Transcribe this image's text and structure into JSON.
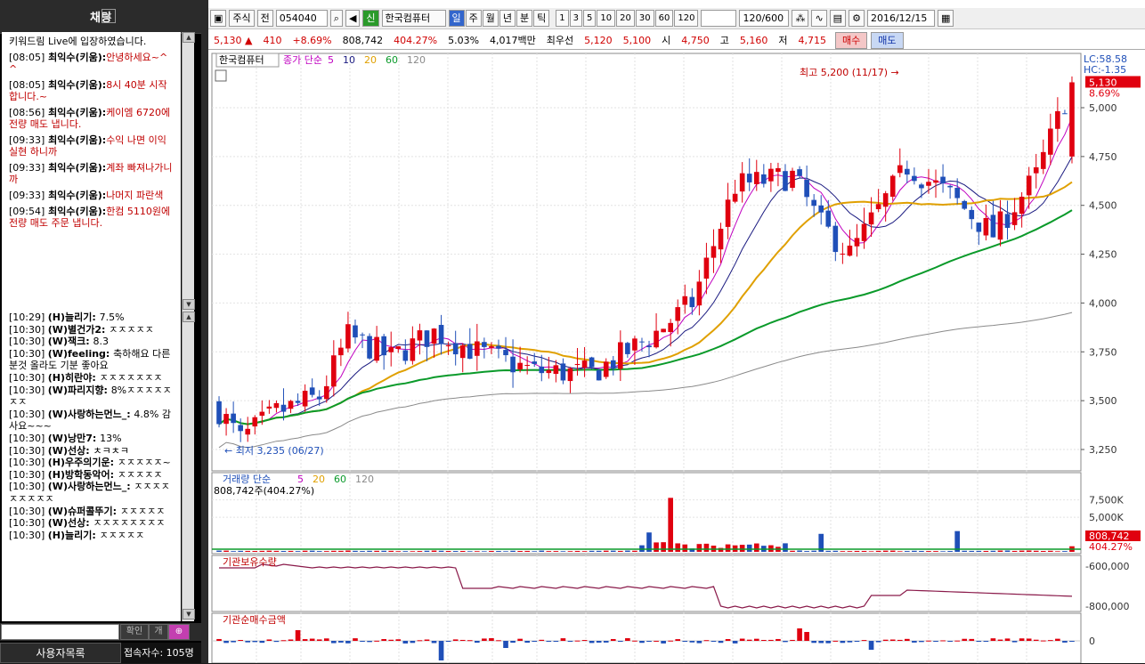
{
  "chat": {
    "title": "채팅",
    "close": "x",
    "messages": [
      {
        "time": "",
        "user": "",
        "text": "키워드림 Live에 입장하였습니다."
      },
      {
        "time": "[08:05]",
        "user": "최익수(키움):",
        "text": "안녕하세요~^^"
      },
      {
        "time": "[08:05]",
        "user": "최익수(키움):",
        "text": "8시 40분 시작합니다.~"
      },
      {
        "time": "[08:56]",
        "user": "최익수(키움):",
        "text": "케이엠 6720에 전량 매도 냅니다."
      },
      {
        "time": "[09:33]",
        "user": "최익수(키움):",
        "text": "수익 나면 이익 실현 하니까"
      },
      {
        "time": "[09:33]",
        "user": "최익수(키움):",
        "text": "계좌 빠져나가니까"
      },
      {
        "time": "[09:33]",
        "user": "최익수(키움):",
        "text": "나머지 파란색"
      },
      {
        "time": "[09:54]",
        "user": "최익수(키움):",
        "text": "한컴 5110원에 전량 매도 주문 냅니다."
      }
    ]
  },
  "log": [
    {
      "time": "[10:29]",
      "user": "(H)늘리기:",
      "text": "7.5%"
    },
    {
      "time": "[10:30]",
      "user": "(W)별건가2:",
      "text": "ㅈㅈㅈㅈㅈ"
    },
    {
      "time": "[10:30]",
      "user": "(W)잭크:",
      "text": "8.3"
    },
    {
      "time": "[10:30]",
      "user": "(W)feeling:",
      "text": "축하해요 다른분것 올라도 기분 좋아요"
    },
    {
      "time": "[10:30]",
      "user": "(H)히란야:",
      "text": "ㅈㅈㅈㅈㅈㅈㅈ"
    },
    {
      "time": "[10:30]",
      "user": "(W)파리지향:",
      "text": "8%ㅈㅈㅈㅈㅈㅈㅈ"
    },
    {
      "time": "[10:30]",
      "user": "(W)사랑하는먼느_:",
      "text": "4.8% 감사요~~~"
    },
    {
      "time": "[10:30]",
      "user": "(W)낭만7:",
      "text": "13%"
    },
    {
      "time": "[10:30]",
      "user": "(W)선상:",
      "text": "ㅊㅋㅊㅋ"
    },
    {
      "time": "[10:30]",
      "user": "(H)우주의기운:",
      "text": "ㅈㅈㅈㅈㅈ~"
    },
    {
      "time": "[10:30]",
      "user": "(H)방학동악어:",
      "text": "ㅈㅈㅈㅈㅈ"
    },
    {
      "time": "[10:30]",
      "user": "(W)사랑하는먼느_:",
      "text": "ㅈㅈㅈㅈㅈㅈㅈㅈㅈ"
    },
    {
      "time": "[10:30]",
      "user": "(W)슈퍼콜뚜기:",
      "text": "ㅈㅈㅈㅈㅈ"
    },
    {
      "time": "[10:30]",
      "user": "(W)선상:",
      "text": "ㅈㅈㅈㅈㅈㅈㅈㅈ"
    },
    {
      "time": "[10:30]",
      "user": "(H)늘리기:",
      "text": "ㅈㅈㅈㅈㅈ"
    }
  ],
  "input_bar": {
    "confirm": "확인",
    "opt1": "개",
    "opt2": "⊕"
  },
  "bottom": {
    "users_label": "사용자목록",
    "count_label": "접속자수: 105명"
  },
  "toolbar": {
    "type": "주식",
    "jeon": "전",
    "code": "054040",
    "badge": "신",
    "name": "한국컴퓨터",
    "periods": [
      "일",
      "주",
      "월",
      "년",
      "분",
      "틱"
    ],
    "selected_period": "일",
    "intervals": [
      "1",
      "3",
      "5",
      "10",
      "20",
      "30",
      "60",
      "120"
    ],
    "count": "120/600",
    "date": "2016/12/15"
  },
  "quote": {
    "price": "5,130",
    "change": "410",
    "pct": "+8.69%",
    "volume": "808,742",
    "vol_ratio": "404.27%",
    "turnover": "5.03%",
    "amount": "4,017백만",
    "best_label": "최우선",
    "ask": "5,120",
    "bid": "5,100",
    "open_label": "시",
    "open": "4,750",
    "high_label": "고",
    "high": "5,160",
    "low_label": "저",
    "low": "4,715",
    "buy": "매수",
    "sell": "매도"
  },
  "chart_data": {
    "type": "candlestick",
    "legend": {
      "name": "한국컴퓨터",
      "label": "종가 단순",
      "ma": [
        "5",
        "10",
        "20",
        "60",
        "120"
      ]
    },
    "price_axis": [
      "5,000",
      "4,750",
      "4,500",
      "4,250",
      "4,000",
      "3,750",
      "3,500",
      "3,250"
    ],
    "lc": "LC:58.58",
    "hc": "HC:-1.35",
    "current": "5,130",
    "current_pct": "8.69%",
    "high_note": "최고 5,200 (11/17)",
    "low_note": "최저 3,235 (06/27)",
    "colors": {
      "up": "#e0000f",
      "down": "#1f4fb8",
      "ma5": "#c000c0",
      "ma10": "#1a1a80",
      "ma20": "#e0a000",
      "ma60": "#0a9a2a",
      "ma120": "#8a8a8a"
    },
    "volume": {
      "label": "거래량",
      "sub": "단순",
      "ma": [
        "5",
        "20",
        "60",
        "120"
      ],
      "value_text": "808,742주(404.27%)",
      "axis": [
        "7,500K",
        "5,000K"
      ],
      "current": "808,742",
      "current_pct": "404.27%"
    },
    "inst_hold": {
      "label": "기관보유수량",
      "axis": [
        "-600,000",
        "-800,000"
      ]
    },
    "inst_net": {
      "label": "기관순매수금액",
      "axis": [
        "0"
      ]
    }
  }
}
